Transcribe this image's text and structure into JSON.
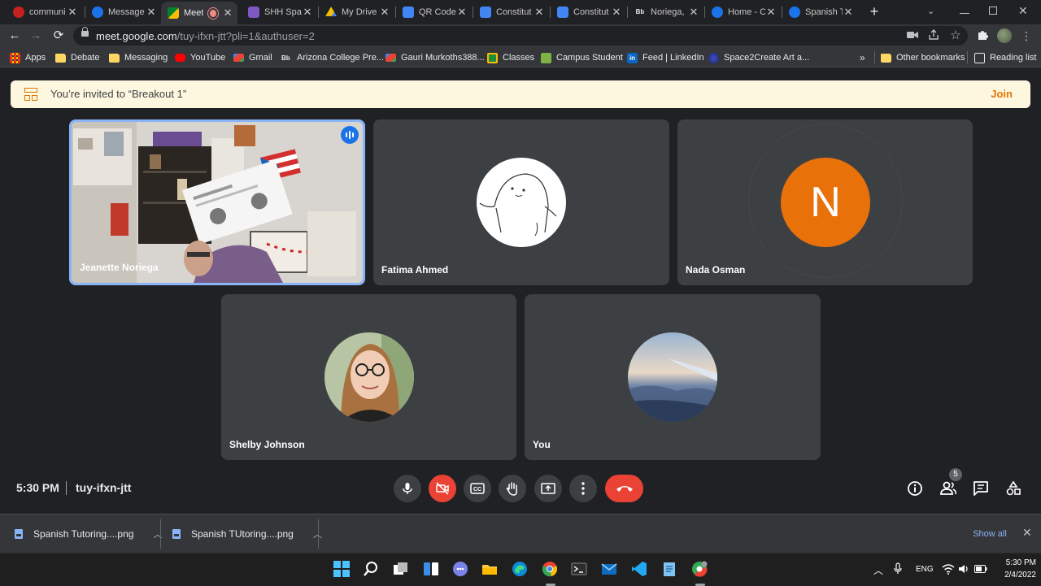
{
  "browser": {
    "tabs": [
      {
        "title": "communi",
        "favicon_color": "#c5221f",
        "active": false
      },
      {
        "title": "Message",
        "favicon_color": "#1a73e8",
        "active": false
      },
      {
        "title": "Meet",
        "favicon_color": "#00832d",
        "active": true,
        "recording": true
      },
      {
        "title": "SHH Span",
        "favicon_color": "#7e57c2",
        "active": false
      },
      {
        "title": "My Drive",
        "favicon_color": "#fbbc04",
        "active": false
      },
      {
        "title": "QR Code",
        "favicon_color": "#4285f4",
        "active": false
      },
      {
        "title": "Constitut",
        "favicon_color": "#4285f4",
        "active": false
      },
      {
        "title": "Constitut",
        "favicon_color": "#4285f4",
        "active": false
      },
      {
        "title": "Noriega,",
        "favicon_color": "#202124",
        "active": false
      },
      {
        "title": "Home - C",
        "favicon_color": "#1a73e8",
        "active": false
      },
      {
        "title": "Spanish T",
        "favicon_color": "#1a73e8",
        "active": false
      }
    ],
    "new_tab_label": "+",
    "url_host": "meet.google.com",
    "url_path": "/tuy-ifxn-jtt?pli=1&authuser=2",
    "bookmarks": [
      {
        "label": "Apps",
        "icon": "apps-grid-icon"
      },
      {
        "label": "Debate",
        "icon": "folder-icon"
      },
      {
        "label": "Messaging",
        "icon": "folder-icon"
      },
      {
        "label": "YouTube",
        "icon": "youtube-icon"
      },
      {
        "label": "Gmail",
        "icon": "gmail-icon"
      },
      {
        "label": "Arizona College Pre...",
        "icon": "blackboard-icon"
      },
      {
        "label": "Gauri Murkoths388...",
        "icon": "gmail-icon"
      },
      {
        "label": "Classes",
        "icon": "classroom-icon"
      },
      {
        "label": "Campus Student",
        "icon": "campus-icon"
      },
      {
        "label": "Feed | LinkedIn",
        "icon": "linkedin-icon"
      },
      {
        "label": "Space2Create Art a...",
        "icon": "space2create-icon"
      }
    ],
    "bookmarks_overflow": "»",
    "other_bookmarks": "Other bookmarks",
    "reading_list": "Reading list"
  },
  "meet": {
    "banner_text": "You’re invited to “Breakout 1”",
    "banner_action": "Join",
    "participants": [
      {
        "name": "Jeanette Noriega",
        "type": "video",
        "speaking": true
      },
      {
        "name": "Fatima Ahmed",
        "type": "avatar-image"
      },
      {
        "name": "Nada Osman",
        "type": "avatar-initial",
        "initial": "N",
        "color": "#e8710a"
      },
      {
        "name": "Shelby Johnson",
        "type": "avatar-photo"
      },
      {
        "name": "You",
        "type": "avatar-photo"
      }
    ],
    "time": "5:30 PM",
    "meeting_code": "tuy-ifxn-jtt",
    "people_count": "5",
    "controls": [
      "microphone-icon",
      "camera-off-icon",
      "captions-icon",
      "raise-hand-icon",
      "present-screen-icon",
      "more-options-icon",
      "hang-up-icon"
    ],
    "right_controls": [
      "info-icon",
      "people-icon",
      "chat-icon",
      "activities-icon"
    ]
  },
  "downloads": {
    "items": [
      {
        "name": "Spanish Tutoring....png"
      },
      {
        "name": "Spanish TUtoring....png"
      }
    ],
    "show_all": "Show all"
  },
  "taskbar": {
    "language": "ENG",
    "time": "5:30 PM",
    "date": "2/4/2022"
  },
  "colors": {
    "meet_bg": "#202124",
    "tile_bg": "#3c4043",
    "banner_bg": "#fef7e0",
    "accent_orange": "#e37400",
    "end_call_red": "#ea4335",
    "speaking_blue": "#8ab4f8"
  }
}
